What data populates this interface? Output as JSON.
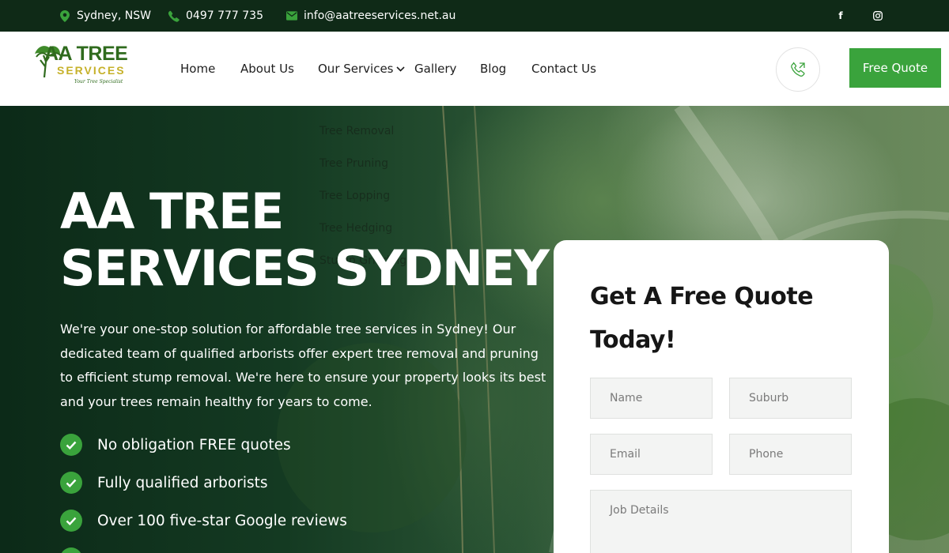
{
  "topbar": {
    "location": "Sydney, NSW",
    "phone": "0497 777 735",
    "email": "info@aatreeservices.net.au",
    "social": [
      "facebook-icon",
      "instagram-icon"
    ]
  },
  "logo": {
    "main": "AA TREE",
    "sub": "SERVICES",
    "tagline": "Your Tree Specialist"
  },
  "nav": {
    "home": "Home",
    "about": "About Us",
    "services": "Our Services",
    "gallery": "Gallery",
    "blog": "Blog",
    "contact": "Contact Us",
    "cta": "Free Quote"
  },
  "services_menu": [
    "Tree Removal",
    "Tree Pruning",
    "Tree Lopping",
    "Tree Hedging",
    "Stump Grinding"
  ],
  "hero": {
    "title_line1": "AA TREE",
    "title_line2": "SERVICES SYDNEY",
    "description": "We're your one-stop solution for affordable tree services in Sydney! Our dedicated team of qualified arborists offer expert tree removal and pruning to efficient stump removal. We're here to ensure your property looks its best and your trees remain healthy for years to come.",
    "checks": [
      "No obligation FREE quotes",
      "Fully qualified arborists",
      "Over 100 five-star Google reviews"
    ]
  },
  "form": {
    "title": "Get A Free Quote Today!",
    "name_placeholder": "Name",
    "suburb_placeholder": "Suburb",
    "email_placeholder": "Email",
    "phone_placeholder": "Phone",
    "details_placeholder": "Job Details"
  },
  "colors": {
    "accent_green": "#3aa33c",
    "topbar_bg": "#0f2a17",
    "logo_green": "#2f6b1d",
    "logo_gold": "#c6b12a"
  }
}
